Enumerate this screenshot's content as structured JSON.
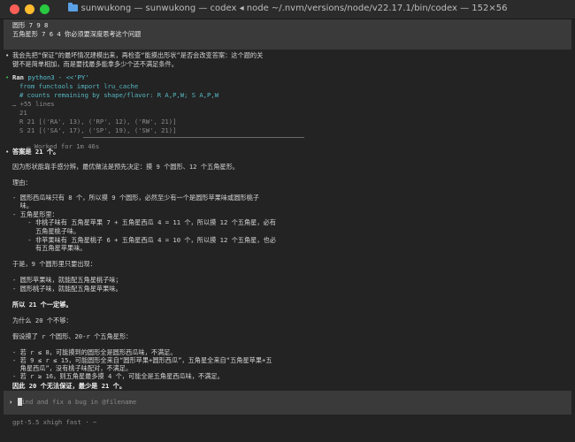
{
  "window": {
    "title": "sunwukong — sunwukong — codex ◂ node ~/.nvm/versions/node/v22.17.1/bin/codex — 152×56",
    "folder_icon": "folder-icon"
  },
  "user_message": {
    "line1": "圆形 7 9 8",
    "line2": "五角星形 7 6 4 你必须要深度思考这个问题"
  },
  "assistant_intro": {
    "bullet": "•",
    "line1": "我会先把“保证”的最坏情况建模出来，再检查“能摸出形状”是否会改变答案：这个题的关",
    "line2": "键不是简单相加，而是要找最多能拿多少个还不满足条件。"
  },
  "ran_block": {
    "bullet": "•",
    "ran": "Ran",
    "command": "python3 - <<'PY'",
    "code1": "from functools import lru_cache",
    "code2": "# counts remaining by shape/flavor: R A,P,W; S A,P,W",
    "more": "… +55 lines",
    "out1": "21",
    "out2": "R 21 [('RA', 13), ('RP', 12), ('RW', 21)]",
    "out3": "S 21 [('SA', 17), ('SP', 19), ('SW', 21)]"
  },
  "worked": {
    "prefix": "—",
    "text": "Worked for 1m 46s"
  },
  "answer": {
    "bullet": "•",
    "l01": "答案是 21 个。",
    "l02": "因为形状能靠手感分辨，最优做法是预先决定：摸 9 个圆形、12 个五角星形。",
    "l03": "理由：",
    "l04": "- 圆形西瓜味只有 8 个，所以摸 9 个圆形，必然至少有一个是圆形苹果味或圆形桃子",
    "l05": "  味。",
    "l06": "- 五角星形里：",
    "l07": "    - 非桃子味有 五角星苹果 7 + 五角星西瓜 4 = 11 个，所以摸 12 个五角星，必有",
    "l08": "      五角星桃子味。",
    "l09": "    - 非苹果味有 五角星桃子 6 + 五角星西瓜 4 = 10 个，所以摸 12 个五角星，也必",
    "l10": "      有五角星苹果味。",
    "l11": "于是，9 个圆形里只要出现：",
    "l12": "- 圆形苹果味，就能配五角星桃子味；",
    "l13": "- 圆形桃子味，就能配五角星苹果味。",
    "l14": "所以 21 个一定够。",
    "l15": "为什么 20 个不够：",
    "l16": "假设摸了 r 个圆形、20-r 个五角星形：",
    "l17": "- 若 r ≤ 8，可能摸到的圆形全是圆形西瓜味，不满足。",
    "l18": "- 若 9 ≤ r ≤ 15，可能圆形全来自“圆形苹果+圆形西瓜”，五角星全来自“五角星苹果+五",
    "l19": "  角星西瓜”，没有桃子味配对，不满足。",
    "l20": "- 若 r ≥ 16，则五角星最多摸 4 个，可能全是五角星西瓜味，不满足。",
    "l21": "因此 20 个无法保证，最少是 21 个。"
  },
  "input": {
    "prompt": "›",
    "placeholder": "Find and fix a bug in @filename"
  },
  "status_bar": {
    "text": "gpt-5.5 xhigh fast · ~"
  }
}
